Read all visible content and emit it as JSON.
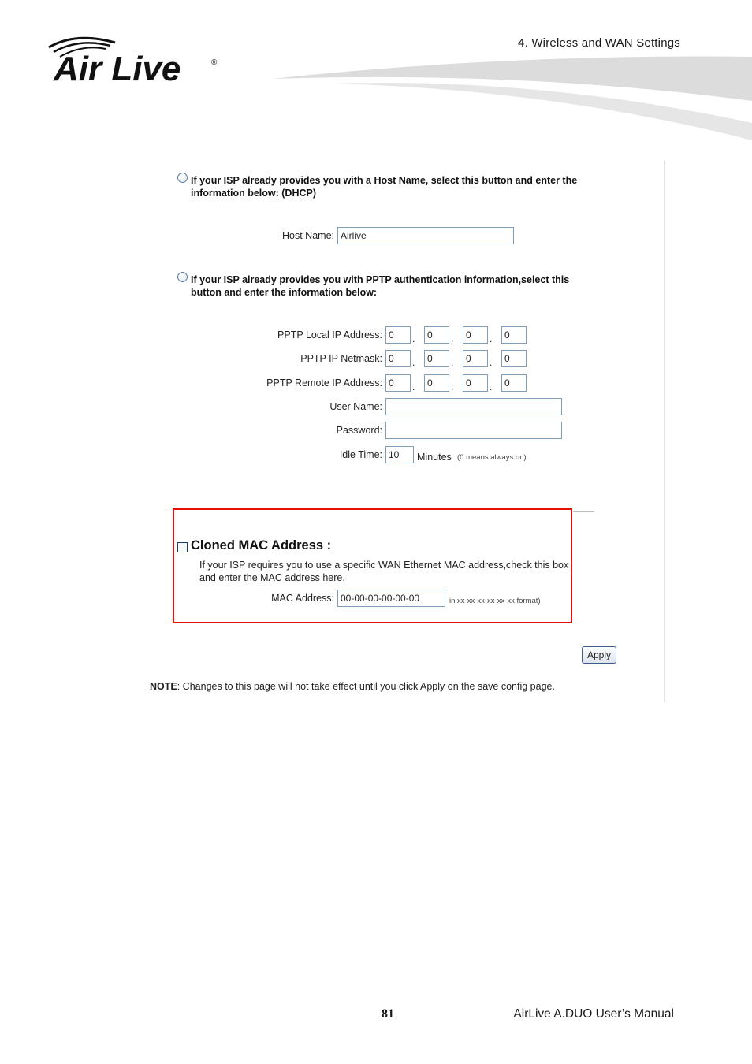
{
  "header": {
    "chapter": "4.  Wireless  and  WAN  Settings",
    "logo_text": "Air Live",
    "logo_mark": "®"
  },
  "dhcp_option": {
    "description": "If your ISP already provides you with a Host Name, select this button and enter the information below: (DHCP)",
    "host_name_label": "Host Name:",
    "host_name_value": "Airlive"
  },
  "pptp_option": {
    "description": "If your ISP already provides you with PPTP authentication information,select this button and enter the information below:",
    "local_ip_label": "PPTP Local IP Address:",
    "local_ip": [
      "0",
      "0",
      "0",
      "0"
    ],
    "netmask_label": "PPTP IP Netmask:",
    "netmask": [
      "0",
      "0",
      "0",
      "0"
    ],
    "remote_ip_label": "PPTP Remote IP Address:",
    "remote_ip": [
      "0",
      "0",
      "0",
      "0"
    ],
    "user_name_label": "User Name:",
    "user_name_value": "",
    "password_label": "Password:",
    "password_value": "",
    "idle_time_label": "Idle Time:",
    "idle_time_value": "10",
    "idle_unit": "Minutes",
    "idle_hint": "(0 means always on)"
  },
  "cloned_mac": {
    "title": "Cloned MAC Address :",
    "description": "If your ISP requires you to use a specific WAN Ethernet MAC address,check this box and enter the MAC address here.",
    "mac_label": "MAC Address:",
    "mac_value": "00-00-00-00-00-00",
    "format_hint": "in xx-xx-xx-xx-xx-xx format)",
    "highlight_color": "#e3120b"
  },
  "apply_label": "Apply",
  "note": {
    "prefix": "NOTE",
    "text": ": Changes to this page will not take effect until you click Apply on the save config page."
  },
  "footer": {
    "page_number": "81",
    "manual_title": "AirLive A.DUO User’s Manual"
  }
}
